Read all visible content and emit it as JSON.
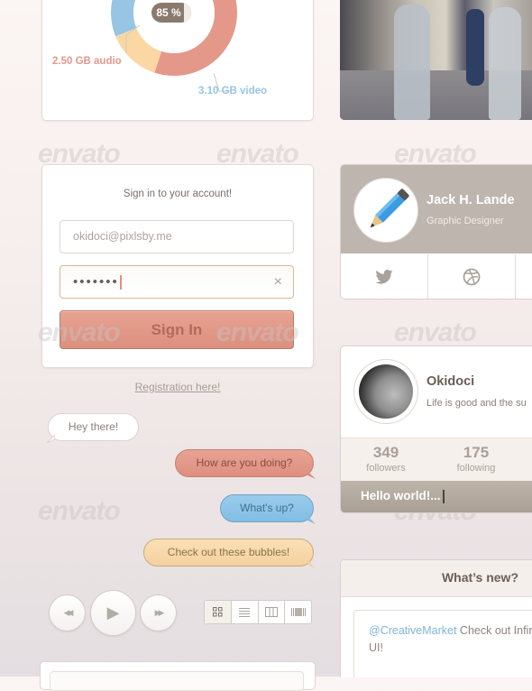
{
  "storage_chart": {
    "center_label": "85 %",
    "percent_used": 85,
    "segments": [
      {
        "name": "audio",
        "label": "2.50 GB audio",
        "value_gb": 2.5,
        "color": "#e4988a"
      },
      {
        "name": "video",
        "label": "3.10 GB video",
        "value_gb": 3.1,
        "color": "#97c5e3"
      },
      {
        "name": "other",
        "label": "",
        "value_gb": 0.9,
        "color": "#fbd7a3"
      }
    ]
  },
  "watermark": "envato",
  "signin": {
    "title": "Sign in to your account!",
    "email_value": "okidoci@pixlsby.me",
    "password_masked": "•••••••",
    "clear_icon": "×",
    "button_label": "Sign In",
    "register_link": "Registration here!"
  },
  "chat": {
    "bubbles": [
      {
        "text": "Hey there!",
        "style": "white"
      },
      {
        "text": "How are you doing?",
        "style": "red"
      },
      {
        "text": "What's up?",
        "style": "blue"
      },
      {
        "text": "Check out these bubbles!",
        "style": "yellow"
      }
    ]
  },
  "player": {
    "rewind_icon": "◀◀",
    "play_icon": "▶",
    "forward_icon": "▶▶"
  },
  "view_switcher": {
    "options": [
      "grid",
      "list",
      "columns",
      "cover-flow"
    ],
    "active": "grid"
  },
  "profile_card_1": {
    "name": "Jack H. Lande",
    "role": "Graphic Designer",
    "socials": [
      "twitter",
      "dribbble"
    ]
  },
  "profile_card_2": {
    "name": "Okidoci",
    "bio": "Life is good and the su",
    "stats": [
      {
        "value": "349",
        "label": "followers"
      },
      {
        "value": "175",
        "label": "following"
      }
    ],
    "post_input_value": "Hello world!..."
  },
  "whats_new": {
    "title": "What’s new?",
    "mention": "@CreativeMarket",
    "text": " Check out Infinite UI!"
  }
}
